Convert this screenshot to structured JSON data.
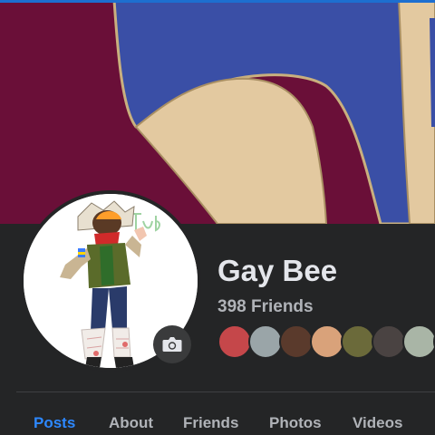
{
  "profile": {
    "name": "Gay Bee",
    "friends_count": "398 Friends"
  },
  "friend_avatars": [
    {
      "color": "#c5474a"
    },
    {
      "color": "#9aa5a8"
    },
    {
      "color": "#5a3a2c"
    },
    {
      "color": "#d9a27a"
    },
    {
      "color": "#6b6a3a"
    },
    {
      "color": "#4a4342"
    },
    {
      "color": "#a9b5a6"
    },
    {
      "color": "#8a6f66"
    }
  ],
  "tabs": [
    {
      "label": "Posts",
      "active": true
    },
    {
      "label": "About",
      "active": false
    },
    {
      "label": "Friends",
      "active": false
    },
    {
      "label": "Photos",
      "active": false
    },
    {
      "label": "Videos",
      "active": false
    }
  ],
  "colors": {
    "background": "#242526",
    "accent": "#2d88ff",
    "cover_maroon": "#6a0f38",
    "cover_blue": "#3a4fa6",
    "cover_tan": "#e3c9a0"
  }
}
